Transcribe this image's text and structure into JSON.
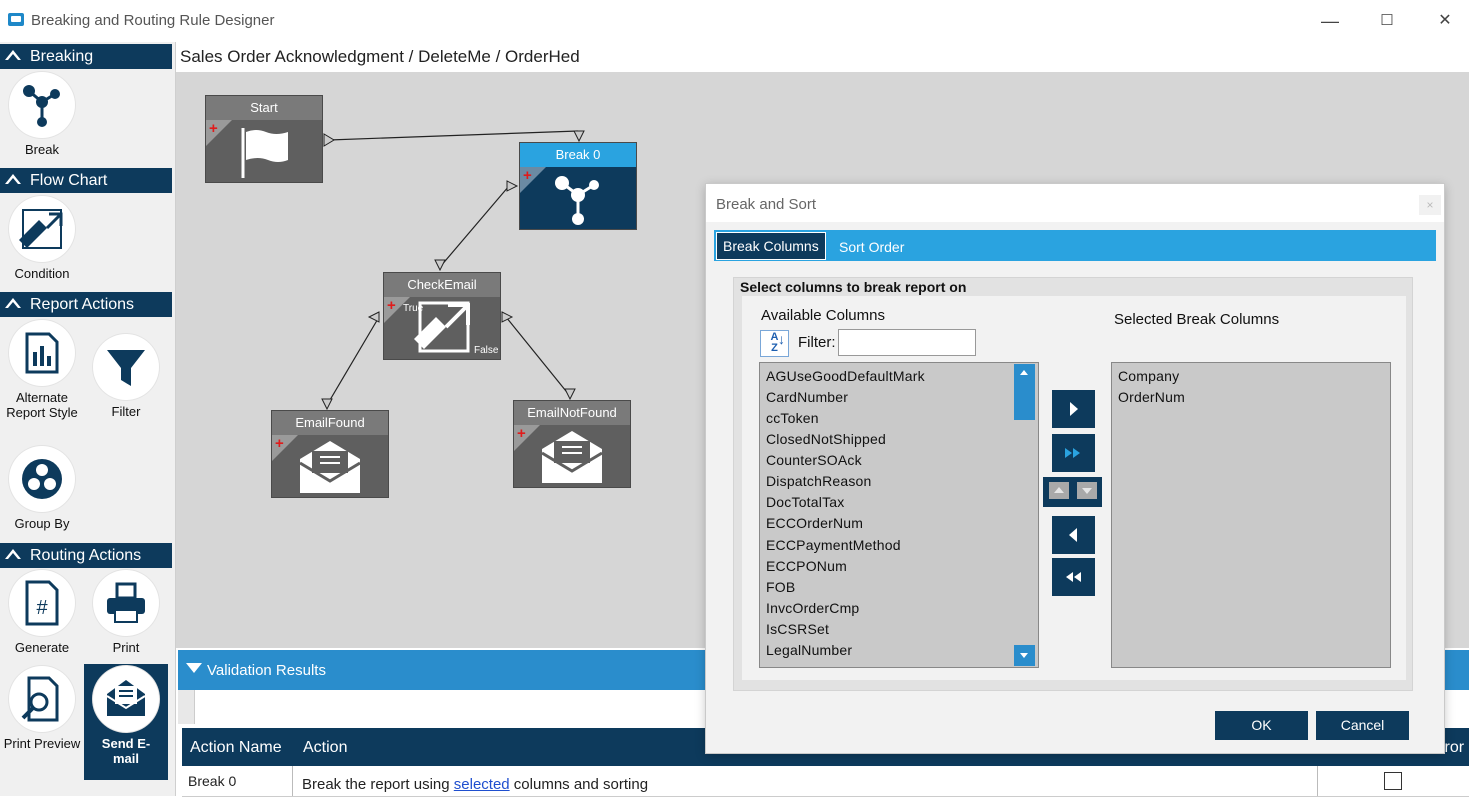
{
  "window": {
    "title": "Breaking and Routing Rule Designer",
    "controls": {
      "minimize": "—",
      "maximize": "☐",
      "close": "✕"
    }
  },
  "palette": {
    "sections": [
      {
        "id": "breaking",
        "label": "Breaking",
        "tools": [
          {
            "label": "Break"
          }
        ]
      },
      {
        "id": "flowchart",
        "label": "Flow Chart",
        "tools": [
          {
            "label": "Condition"
          }
        ]
      },
      {
        "id": "report",
        "label": "Report Actions",
        "tools": [
          {
            "label": "Alternate Report Style"
          },
          {
            "label": "Filter"
          },
          {
            "label": "Group By"
          }
        ]
      },
      {
        "id": "routing",
        "label": "Routing Actions",
        "tools": [
          {
            "label": "Generate"
          },
          {
            "label": "Print"
          },
          {
            "label": "Print Preview"
          },
          {
            "label": "Send E-mail"
          }
        ]
      }
    ]
  },
  "breadcrumb": "Sales Order Acknowledgment / DeleteMe / OrderHed",
  "canvas": {
    "nodes": {
      "start": "Start",
      "break0": "Break 0",
      "checkemail": "CheckEmail",
      "true_label": "True",
      "false_label": "False",
      "emailfound": "EmailFound",
      "emailnotfound": "EmailNotFound"
    }
  },
  "validation": {
    "title": "Validation Results",
    "columns": [
      "Action Name",
      "Action",
      "Terminate On Error"
    ],
    "rows": [
      {
        "name": "Break 0",
        "action_prefix": "Break the report using ",
        "action_link": "selected",
        "action_suffix": " columns and sorting"
      }
    ]
  },
  "dialog": {
    "title": "Break and Sort",
    "close": "×",
    "tabs": [
      "Break Columns",
      "Sort Order"
    ],
    "active_tab": "Break Columns",
    "panel_label": "Select columns to break report on",
    "available_label": "Available Columns",
    "selected_label": "Selected Break Columns",
    "sort_icon": "A Z",
    "filter_label": "Filter:",
    "filter_value": "",
    "available": [
      "AGUseGoodDefaultMark",
      "CardNumber",
      "ccToken",
      "ClosedNotShipped",
      "CounterSOAck",
      "DispatchReason",
      "DocTotalTax",
      "ECCOrderNum",
      "ECCPaymentMethod",
      "ECCPONum",
      "FOB",
      "InvcOrderCmp",
      "IsCSRSet",
      "LegalNumber"
    ],
    "selected": [
      "Company",
      "OrderNum"
    ],
    "ok": "OK",
    "cancel": "Cancel"
  },
  "colors": {
    "navy": "#0d3a5c",
    "accent": "#2aa3e0",
    "node_gray": "#5f5f5f"
  }
}
